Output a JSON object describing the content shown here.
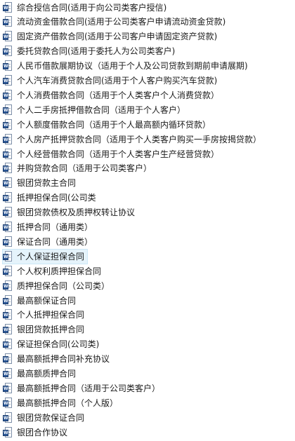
{
  "file_type_icon": "word-document-icon",
  "file_type_badge": "W",
  "selected_index": 17,
  "files": [
    "综合授信合同(适用于向公司类客户授信)",
    "流动资金借款合同(适用于公司类客户申请流动资金贷款)",
    "固定资产借款合同(适用于公司客户申请固定资产贷款)",
    "委托贷款合同(适用于委托人为公司类客户)",
    "人民币借款展期协议（适用于个人及公司贷款到期前申请展期)",
    "个人汽车消费贷款合同(适用于个人客户购买汽车贷款)",
    "个人消费借款合同（适用于个人类客户个人消费贷款）",
    "个人二手房抵押借款合同（适用于个人客户）",
    "个人额度借款合同（适用于个人最高额内循环贷款）",
    "个人房产抵押贷款合同（适用于个人类客户购买一手房按揭贷款）",
    "个人经营借款合同（适用于个人类客户生产经营贷款）",
    "并购贷款合同（适用于公司类客户）",
    "银团贷款主合同",
    "抵押担保合同(公司类",
    "银团贷款债权及质押权转让协议",
    "抵押合同（通用类）",
    "保证合同（通用类）",
    "个人保证担保合同",
    "个人权利质押担保合同",
    "质押担保合同（公司类）",
    "最高额保证合同",
    "个人抵押担保合同",
    "银团贷款抵押合同",
    "保证担保合同(公司类)",
    "最高额抵押合同补充协议",
    "最高额质押合同",
    "最高额抵押合同（适用于公司类客户）",
    "最高额抵押合同（个人版）",
    "银团贷款保证合同",
    "银团合作协议"
  ]
}
